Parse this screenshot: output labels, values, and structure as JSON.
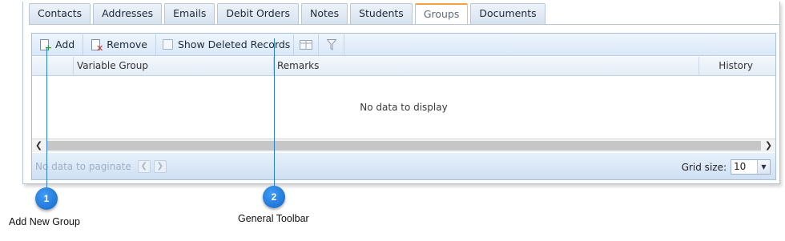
{
  "tabs": [
    "Contacts",
    "Addresses",
    "Emails",
    "Debit Orders",
    "Notes",
    "Students",
    "Groups",
    "Documents"
  ],
  "active_tab": "Groups",
  "toolbar": {
    "add_label": "Add",
    "remove_label": "Remove",
    "show_deleted_label": "Show Deleted Records"
  },
  "grid": {
    "columns": [
      "Variable Group",
      "Remarks",
      "History"
    ],
    "empty_text": "No data to display"
  },
  "pager": {
    "text": "No data to paginate",
    "grid_size_label": "Grid size:",
    "grid_size_value": "10"
  },
  "callouts": [
    {
      "number": "1",
      "label": "Add New Group"
    },
    {
      "number": "2",
      "label": "General Toolbar"
    }
  ],
  "colors": {
    "callout": "#1e7be0",
    "active_tab_accent": "#f3a33a"
  }
}
